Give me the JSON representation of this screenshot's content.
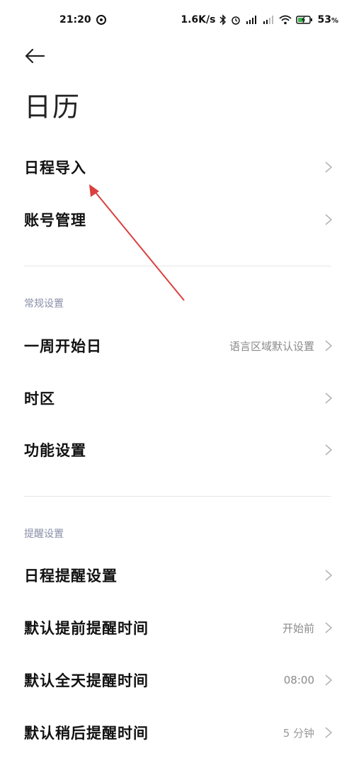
{
  "status_bar": {
    "time": "21:20",
    "network_speed": "1.6K/s",
    "battery_percent": "53",
    "battery_unit": "%",
    "icons": [
      "sync-icon",
      "bluetooth-icon",
      "alarm-icon",
      "signal-hd-1-icon",
      "signal-hd-2-icon",
      "wifi-icon",
      "battery-charging-icon"
    ]
  },
  "header": {
    "back_icon": "arrow-left-icon",
    "title": "日历"
  },
  "rows": {
    "import": {
      "label": "日程导入"
    },
    "account": {
      "label": "账号管理"
    },
    "week_start": {
      "label": "一周开始日",
      "value": "语言区域默认设置"
    },
    "timezone": {
      "label": "时区"
    },
    "features": {
      "label": "功能设置"
    },
    "event_reminder": {
      "label": "日程提醒设置"
    },
    "default_advance": {
      "label": "默认提前提醒时间",
      "value": "开始前"
    },
    "default_allday": {
      "label": "默认全天提醒时间",
      "value": "08:00"
    },
    "default_snooze": {
      "label": "默认稍后提醒时间",
      "value": "5 分钟"
    }
  },
  "sections": {
    "general": "常规设置",
    "reminders": "提醒设置"
  },
  "colors": {
    "annotation_arrow": "#d94040",
    "section_header": "#8a8fa8",
    "value_text": "#8a8a8a"
  }
}
